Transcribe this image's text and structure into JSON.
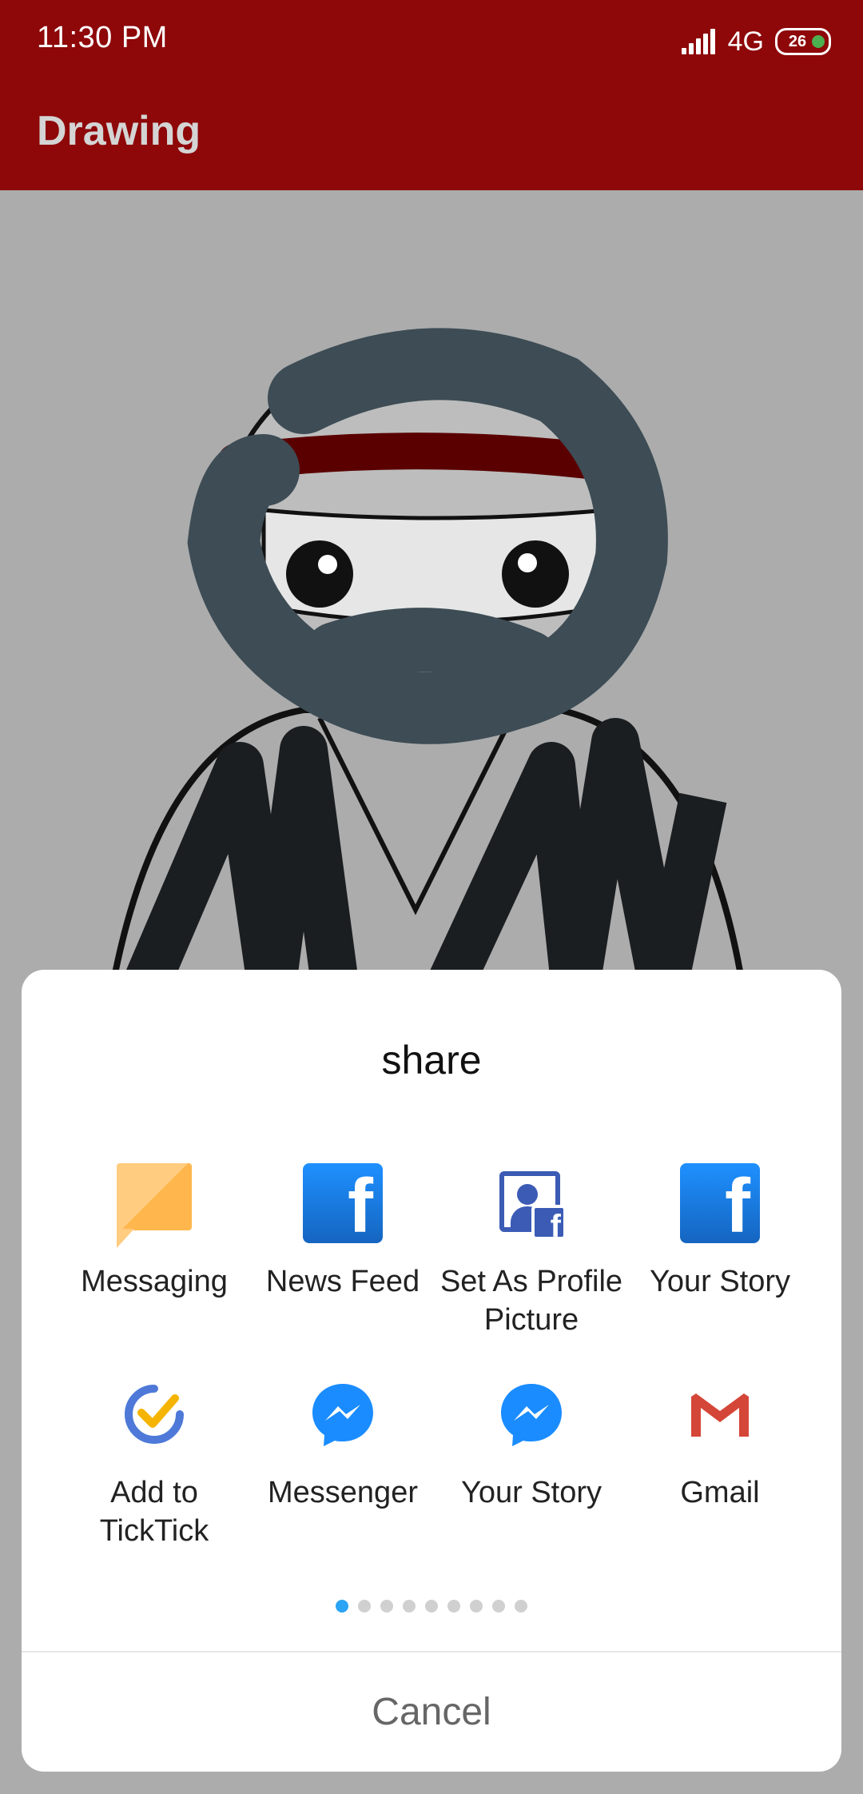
{
  "status_bar": {
    "time": "11:30  PM",
    "network": "4G",
    "battery": "26"
  },
  "app_bar": {
    "title": "Drawing"
  },
  "share_sheet": {
    "title": "share",
    "items": [
      {
        "label": "Messaging",
        "icon": "messaging-icon"
      },
      {
        "label": "News Feed",
        "icon": "facebook-icon"
      },
      {
        "label": "Set As Profile Picture",
        "icon": "facebook-profile-icon"
      },
      {
        "label": "Your Story",
        "icon": "facebook-icon"
      },
      {
        "label": "Add to TickTick",
        "icon": "ticktick-icon"
      },
      {
        "label": "Messenger",
        "icon": "messenger-icon"
      },
      {
        "label": "Your Story",
        "icon": "messenger-icon"
      },
      {
        "label": "Gmail",
        "icon": "gmail-icon"
      }
    ],
    "page_count": 9,
    "active_page": 1,
    "cancel_label": "Cancel"
  },
  "colors": {
    "app_bar": "#8e0709",
    "accent_dot": "#2aa4f4",
    "facebook_blue": "#1877f2"
  }
}
